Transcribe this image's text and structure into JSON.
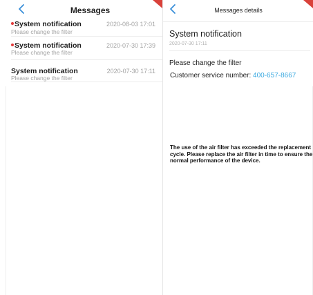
{
  "messages_screen": {
    "title": "Messages",
    "items": [
      {
        "title": "System notification",
        "subtitle": "Please change the filter",
        "time": "2020-08-03 17:01",
        "unread": true
      },
      {
        "title": "System notification",
        "subtitle": "Please change the filter",
        "time": "2020-07-30 17:39",
        "unread": true
      },
      {
        "title": "System notification",
        "subtitle": "Please change the filter",
        "time": "2020-07-30 17:11",
        "unread": false
      }
    ]
  },
  "details_screen": {
    "title": "Messages details",
    "message_title": "System notification",
    "message_date": "2020-07-30 17:11",
    "line1": "Please change the filter",
    "service_label": "Customer service number: ",
    "service_number": "400-657-8667",
    "body": "The use of the air filter has exceeded the replacement cycle. Please replace the air filter in time to ensure the normal performance of the device."
  },
  "colors": {
    "accent": "#38a8e0",
    "unread_dot": "#e23b3b",
    "ribbon": "#d9413a",
    "muted_text": "#a3a3a3"
  },
  "icons": {
    "back": "chevron-left-icon"
  }
}
